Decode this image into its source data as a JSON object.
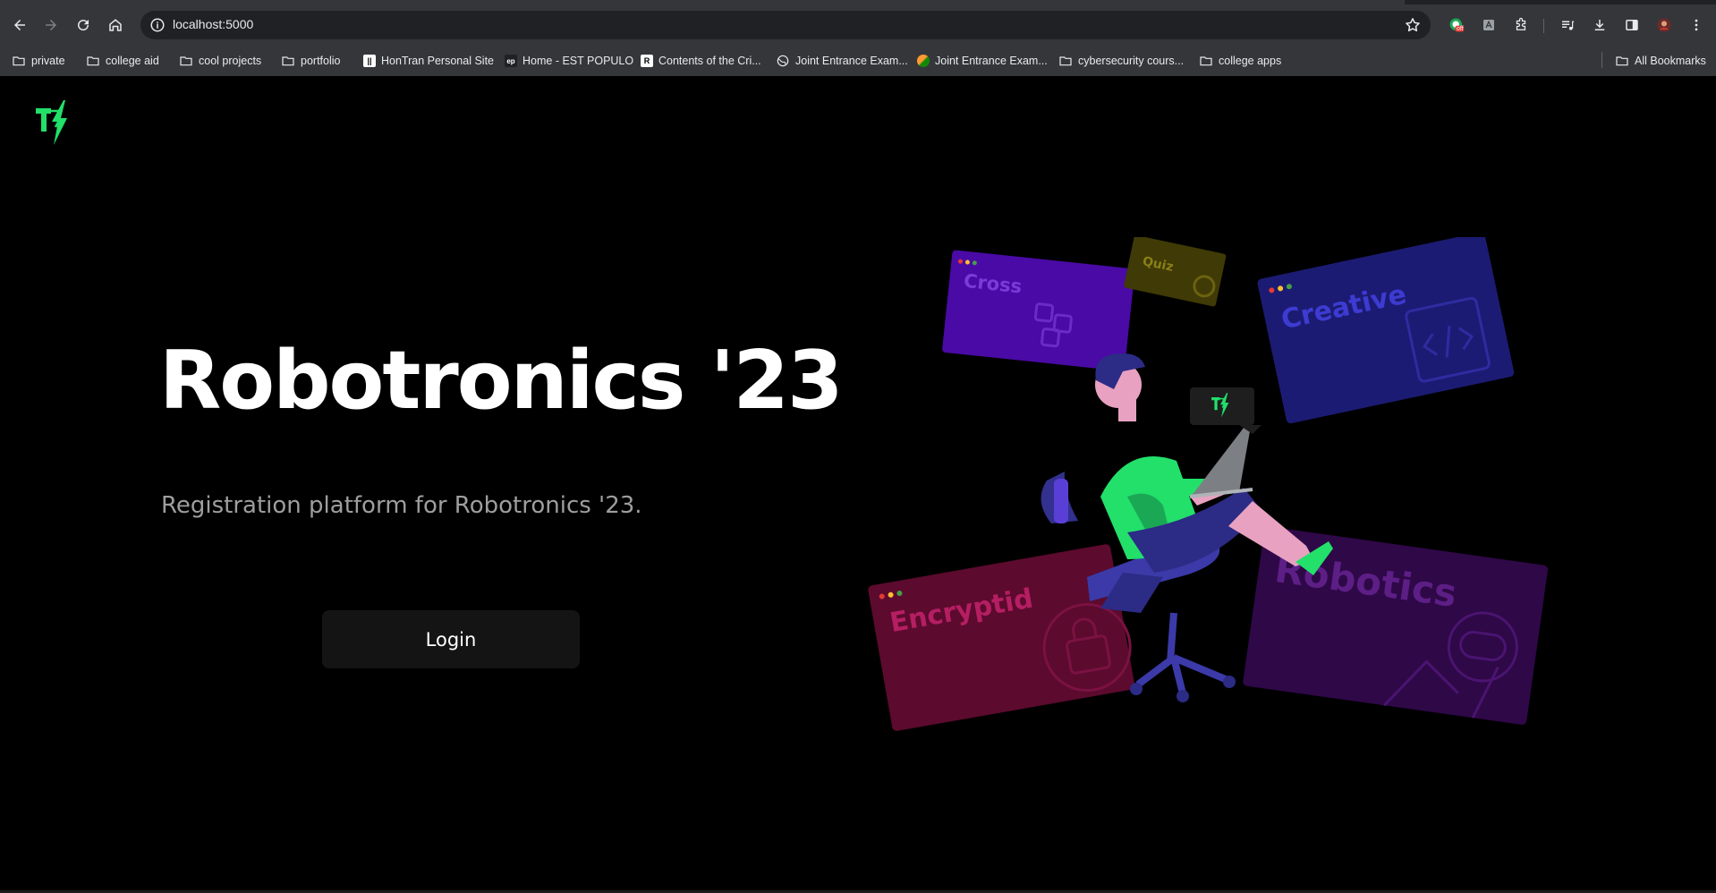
{
  "browser": {
    "url": "localhost:5000",
    "extension_badge": "off",
    "bookmarks": [
      {
        "label": "private",
        "icon": "folder-icon"
      },
      {
        "label": "college aid",
        "icon": "folder-icon"
      },
      {
        "label": "cool projects",
        "icon": "folder-icon"
      },
      {
        "label": "portfolio",
        "icon": "folder-icon"
      },
      {
        "label": "HonTran Personal Site",
        "icon": "site-favicon"
      },
      {
        "label": "Home - EST POPULO",
        "icon": "ep-favicon"
      },
      {
        "label": "Contents of the Cri...",
        "icon": "r-favicon"
      },
      {
        "label": "Joint Entrance Exam...",
        "icon": "globe-icon"
      },
      {
        "label": "Joint Entrance Exam...",
        "icon": "emblem-favicon"
      },
      {
        "label": "cybersecurity cours...",
        "icon": "folder-icon"
      },
      {
        "label": "college apps",
        "icon": "folder-icon"
      }
    ],
    "all_bookmarks_label": "All Bookmarks"
  },
  "page": {
    "logo_icon": "robotronics-logo-icon",
    "title": "Robotronics '23",
    "subtitle": "Registration platform for Robotronics '23.",
    "login_label": "Login",
    "illustration": {
      "laptop_sticker_icon": "robotronics-logo-icon",
      "cards": [
        {
          "label": "Cross",
          "color": "#4a0aa6"
        },
        {
          "label": "Quiz",
          "color": "#3f3a06"
        },
        {
          "label": "Creative",
          "color": "#1c1b73"
        },
        {
          "label": "Encryptid",
          "color": "#5c0a2e"
        },
        {
          "label": "Robotics",
          "color": "#2f0848"
        }
      ]
    }
  },
  "colors": {
    "accent": "#22e06a",
    "background": "#000000",
    "chrome": "#35363a"
  }
}
